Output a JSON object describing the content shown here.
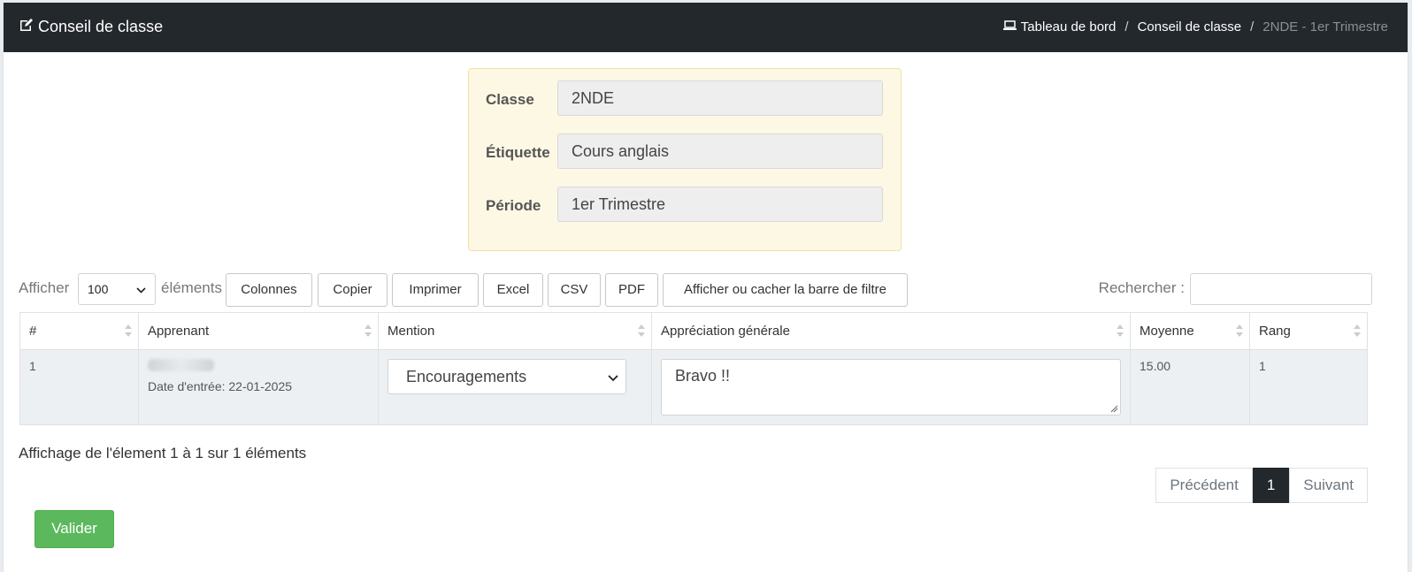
{
  "header": {
    "title": "Conseil de classe",
    "breadcrumb": [
      {
        "label": "Tableau de bord"
      },
      {
        "label": "Conseil de classe"
      },
      {
        "label": "2NDE - 1er Trimestre"
      }
    ]
  },
  "info": {
    "classe_label": "Classe",
    "classe_value": "2NDE",
    "etiquette_label": "Étiquette",
    "etiquette_value": "Cours anglais",
    "periode_label": "Période",
    "periode_value": "1er Trimestre"
  },
  "toolbar": {
    "show_label": "Afficher",
    "page_size": "100",
    "elements_label": "éléments",
    "buttons": [
      "Colonnes",
      "Copier",
      "Imprimer",
      "Excel",
      "CSV",
      "PDF",
      "Afficher ou cacher la barre de filtre"
    ],
    "search_label": "Rechercher :"
  },
  "table": {
    "headers": [
      "#",
      "Apprenant",
      "Mention",
      "Appréciation générale",
      "Moyenne",
      "Rang"
    ],
    "rows": [
      {
        "num": "1",
        "date_entree": "Date d'entrée: 22-01-2025",
        "mention": "Encouragements",
        "appreciation": "Bravo !!",
        "moyenne": "15.00",
        "rang": "1"
      }
    ]
  },
  "footer": {
    "info": "Affichage de l'élement 1 à 1 sur 1 éléments",
    "prev": "Précédent",
    "page": "1",
    "next": "Suivant",
    "submit": "Valider"
  },
  "colors": {
    "header_bg": "#23282d",
    "info_bg": "#fdf8e4",
    "submit_bg": "#5cb85c"
  }
}
